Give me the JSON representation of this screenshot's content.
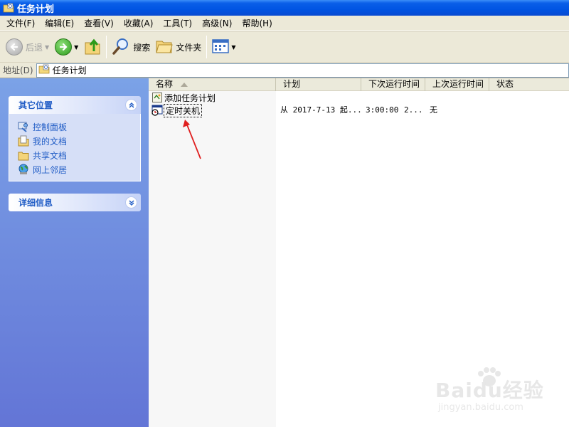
{
  "window": {
    "title": "任务计划"
  },
  "menu": {
    "items": [
      "文件(F)",
      "编辑(E)",
      "查看(V)",
      "收藏(A)",
      "工具(T)",
      "高级(N)",
      "帮助(H)"
    ]
  },
  "toolbar": {
    "back_label": "后退",
    "search_label": "搜索",
    "folders_label": "文件夹"
  },
  "address": {
    "label": "地址(D)",
    "value": "任务计划"
  },
  "taskpane": {
    "other_places": {
      "title": "其它位置",
      "links": [
        "控制面板",
        "我的文档",
        "共享文档",
        "网上邻居"
      ]
    },
    "details": {
      "title": "详细信息"
    }
  },
  "list": {
    "columns": [
      "名称",
      "计划",
      "下次运行时间",
      "上次运行时间",
      "状态"
    ],
    "rows": [
      {
        "name": "添加任务计划",
        "schedule": "",
        "next_run": "",
        "last_run": "",
        "status": ""
      },
      {
        "name": "定时关机",
        "schedule": "从 2017-7-13 起...",
        "next_run": "3:00:00",
        "last_run": "2...",
        "status": "无"
      }
    ]
  },
  "watermark": {
    "brand": "Baidu经验",
    "url": "jingyan.baidu.com"
  },
  "colors": {
    "titlebar": "#0054e3",
    "taskpane": "#7ba2e7",
    "link": "#215dc6",
    "annotation": "#e02020"
  }
}
